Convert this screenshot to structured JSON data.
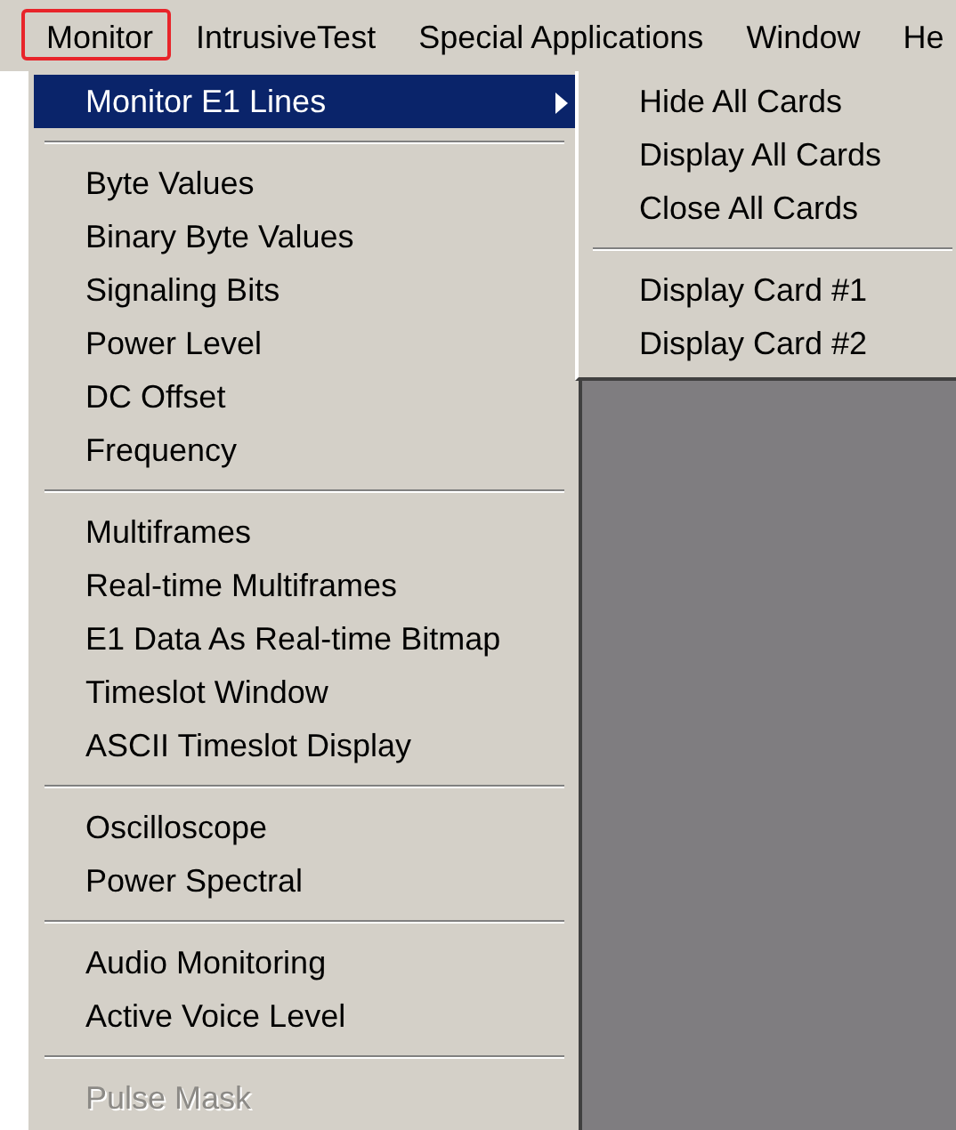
{
  "menubar": [
    {
      "label": "Monitor",
      "selected": true
    },
    {
      "label": "IntrusiveTest",
      "selected": false
    },
    {
      "label": "Special Applications",
      "selected": false
    },
    {
      "label": "Window",
      "selected": false
    },
    {
      "label": "He",
      "selected": false
    }
  ],
  "menu": [
    {
      "kind": "item",
      "label": "Monitor E1 Lines",
      "selected": true,
      "submenu": true,
      "disabled": false
    },
    {
      "kind": "separator"
    },
    {
      "kind": "item",
      "label": "Byte Values",
      "selected": false,
      "submenu": false,
      "disabled": false
    },
    {
      "kind": "item",
      "label": "Binary Byte Values",
      "selected": false,
      "submenu": false,
      "disabled": false
    },
    {
      "kind": "item",
      "label": "Signaling Bits",
      "selected": false,
      "submenu": false,
      "disabled": false
    },
    {
      "kind": "item",
      "label": "Power Level",
      "selected": false,
      "submenu": false,
      "disabled": false
    },
    {
      "kind": "item",
      "label": "DC Offset",
      "selected": false,
      "submenu": false,
      "disabled": false
    },
    {
      "kind": "item",
      "label": "Frequency",
      "selected": false,
      "submenu": false,
      "disabled": false
    },
    {
      "kind": "separator"
    },
    {
      "kind": "item",
      "label": "Multiframes",
      "selected": false,
      "submenu": false,
      "disabled": false
    },
    {
      "kind": "item",
      "label": "Real-time Multiframes",
      "selected": false,
      "submenu": false,
      "disabled": false
    },
    {
      "kind": "item",
      "label": "E1 Data As Real-time Bitmap",
      "selected": false,
      "submenu": false,
      "disabled": false
    },
    {
      "kind": "item",
      "label": "Timeslot Window",
      "selected": false,
      "submenu": false,
      "disabled": false
    },
    {
      "kind": "item",
      "label": "ASCII Timeslot Display",
      "selected": false,
      "submenu": false,
      "disabled": false
    },
    {
      "kind": "separator"
    },
    {
      "kind": "item",
      "label": "Oscilloscope",
      "selected": false,
      "submenu": false,
      "disabled": false
    },
    {
      "kind": "item",
      "label": "Power Spectral",
      "selected": false,
      "submenu": false,
      "disabled": false
    },
    {
      "kind": "separator"
    },
    {
      "kind": "item",
      "label": "Audio Monitoring",
      "selected": false,
      "submenu": false,
      "disabled": false
    },
    {
      "kind": "item",
      "label": "Active Voice Level",
      "selected": false,
      "submenu": false,
      "disabled": false
    },
    {
      "kind": "separator"
    },
    {
      "kind": "item",
      "label": "Pulse Mask",
      "selected": false,
      "submenu": false,
      "disabled": true
    }
  ],
  "submenu": [
    {
      "kind": "item",
      "label": "Hide All Cards"
    },
    {
      "kind": "item",
      "label": "Display All Cards"
    },
    {
      "kind": "item",
      "label": "Close All Cards"
    },
    {
      "kind": "separator"
    },
    {
      "kind": "item",
      "label": "Display Card #1"
    },
    {
      "kind": "item",
      "label": "Display Card #2"
    }
  ]
}
